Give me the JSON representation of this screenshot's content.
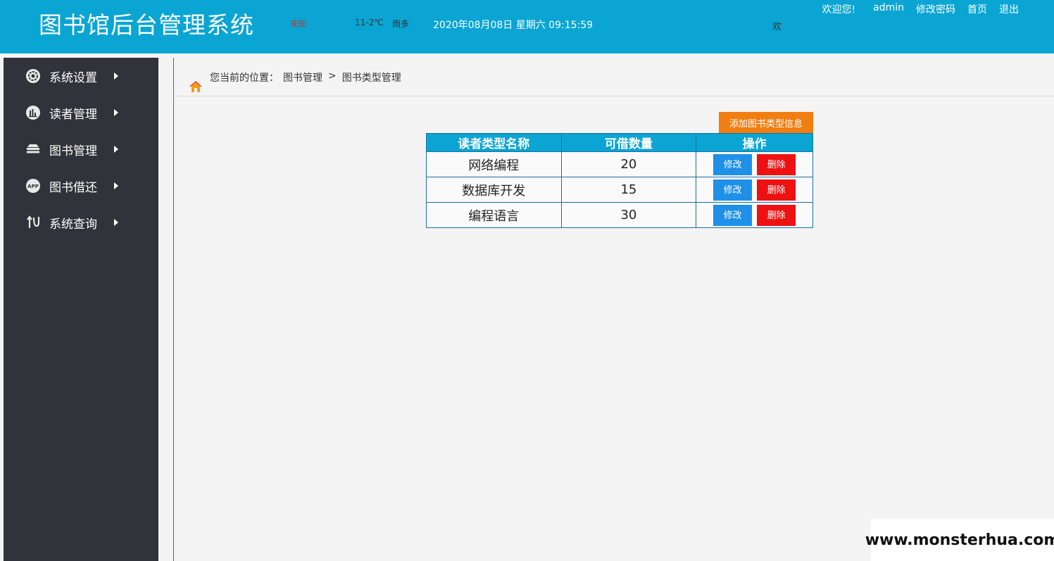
{
  "header": {
    "title": "图书馆后台管理系统",
    "weather_status": "未知",
    "weather_temp": "11-2℃",
    "weather_desc": "雨多",
    "datetime": "2020年08月08日 星期六 09:15:59",
    "marquee": "欢",
    "welcome": "欢迎您!",
    "username": "admin",
    "change_password": "修改密码",
    "home": "首页",
    "logout": "退出"
  },
  "sidebar": {
    "items": [
      {
        "label": "系统设置",
        "icon": "gear-icon"
      },
      {
        "label": "读者管理",
        "icon": "bar-chart-icon"
      },
      {
        "label": "图书管理",
        "icon": "layers-icon"
      },
      {
        "label": "图书借还",
        "icon": "app-icon"
      },
      {
        "label": "系统查询",
        "icon": "swap-icon"
      }
    ]
  },
  "breadcrumb": {
    "prefix": "您当前的位置：",
    "level1": "图书管理",
    "separator": ">",
    "level2": "图书类型管理"
  },
  "toolbar": {
    "add_label": "添加图书类型信息"
  },
  "table": {
    "headers": [
      "读者类型名称",
      "可借数量",
      "操作"
    ],
    "rows": [
      {
        "name": "网络编程",
        "count": "20"
      },
      {
        "name": "数据库开发",
        "count": "15"
      },
      {
        "name": "编程语言",
        "count": "30"
      }
    ],
    "edit_label": "修改",
    "delete_label": "删除"
  },
  "watermark": "www.monsterhua.com",
  "colors": {
    "header_bg": "#0aa5d3",
    "sidebar_bg": "#32323a",
    "add_button": "#f07e10",
    "edit_button": "#1e90e8",
    "delete_button": "#ee1111"
  }
}
